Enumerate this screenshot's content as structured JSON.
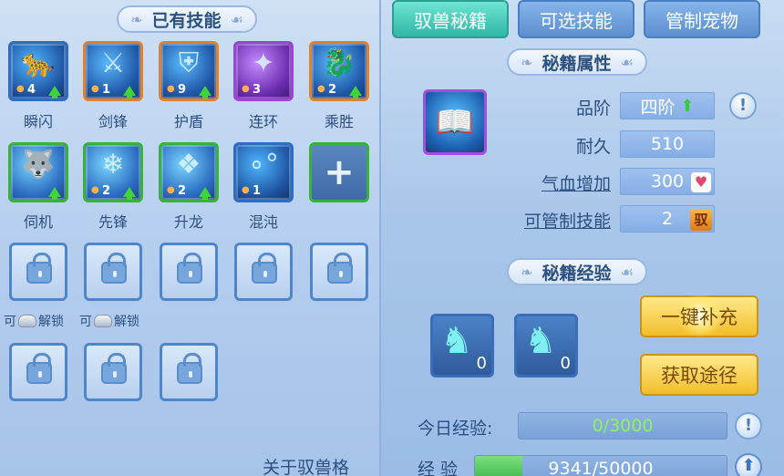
{
  "left": {
    "header": "已有技能",
    "skills": [
      {
        "label": "瞬闪",
        "level": "4",
        "icon": "panther-icon",
        "frame": "blue"
      },
      {
        "label": "剑锋",
        "level": "1",
        "icon": "sword-slash-icon",
        "frame": "orange"
      },
      {
        "label": "护盾",
        "level": "9",
        "icon": "shield-icon",
        "frame": "orange"
      },
      {
        "label": "连环",
        "level": "3",
        "icon": "claw-icon",
        "frame": "purple"
      },
      {
        "label": "乘胜",
        "level": "2",
        "icon": "dragon-icon",
        "frame": "orange"
      },
      {
        "label": "伺机",
        "level": "",
        "icon": "wolf-icon",
        "frame": "green"
      },
      {
        "label": "先锋",
        "level": "2",
        "icon": "ice-shard-icon",
        "frame": "green"
      },
      {
        "label": "升龙",
        "level": "2",
        "icon": "rising-dragon-icon",
        "frame": "green"
      },
      {
        "label": "混沌",
        "level": "1",
        "icon": "bubbles-icon",
        "frame": "blue"
      }
    ],
    "add_label": "+",
    "unlock_hint_prefix": "可",
    "unlock_hint_suffix": "解锁",
    "footer_link": "关于驭兽格"
  },
  "tabs": [
    "驭兽秘籍",
    "可选技能",
    "管制宠物"
  ],
  "attributes": {
    "header": "秘籍属性",
    "rows": [
      {
        "label": "品阶",
        "value": "四阶"
      },
      {
        "label": "耐久",
        "value": "510"
      },
      {
        "label": "气血增加",
        "value": "300"
      },
      {
        "label": "可管制技能",
        "value": "2",
        "tag": "驭"
      }
    ]
  },
  "experience": {
    "header": "秘籍经验",
    "items": [
      {
        "count": "0",
        "icon": "spirit-horse-icon"
      },
      {
        "count": "0",
        "icon": "spirit-horse-icon"
      }
    ],
    "one_click_label": "一键补充",
    "acquire_label": "获取途径",
    "today_label": "今日经验:",
    "today_value": "0/3000",
    "exp_label": "经 验",
    "exp_value": "9341/50000",
    "exp_fraction": 0.187
  },
  "colors": {
    "active_tab": "#2fb6a6",
    "tab": "#5c8fd0",
    "gold_button": "#f2bf2a",
    "upgrade_arrow": "#3fd43a"
  }
}
